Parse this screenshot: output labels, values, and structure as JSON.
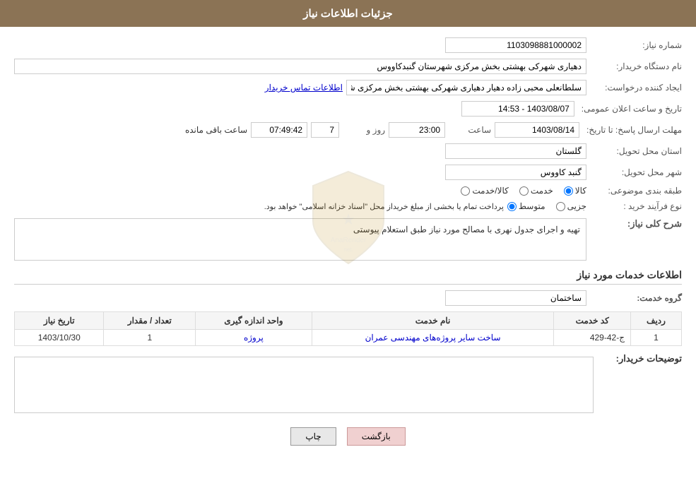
{
  "header": {
    "title": "جزئیات اطلاعات نیاز"
  },
  "form": {
    "need_number_label": "شماره نیاز:",
    "need_number_value": "1103098881000002",
    "buyer_org_label": "نام دستگاه خریدار:",
    "buyer_org_value": "دهیاری شهرکی بهشتی بخش مرکزی شهرستان گنبدکاووس",
    "creator_label": "ایجاد کننده درخواست:",
    "creator_value": "سلطانعلی محبی زاده دهیار دهیاری شهرکی بهشتی بخش مرکزی شهرستان گ",
    "creator_link": "اطلاعات تماس خریدار",
    "announce_label": "تاریخ و ساعت اعلان عمومی:",
    "announce_value": "1403/08/07 - 14:53",
    "deadline_label": "مهلت ارسال پاسخ: تا تاریخ:",
    "deadline_date": "1403/08/14",
    "deadline_time_label": "ساعت",
    "deadline_time": "23:00",
    "deadline_days_label": "روز و",
    "deadline_days": "7",
    "remaining_label": "ساعت باقی مانده",
    "remaining_time": "07:49:42",
    "province_label": "استان محل تحویل:",
    "province_value": "گلستان",
    "city_label": "شهر محل تحویل:",
    "city_value": "گنبد کاووس",
    "category_label": "طبقه بندی موضوعی:",
    "category_options": [
      {
        "id": "kala",
        "label": "کالا"
      },
      {
        "id": "khadamat",
        "label": "خدمت"
      },
      {
        "id": "kala_khadamat",
        "label": "کالا/خدمت"
      }
    ],
    "category_selected": "kala",
    "purchase_label": "نوع فرآیند خرید :",
    "purchase_options": [
      {
        "id": "jozi",
        "label": "جزیی"
      },
      {
        "id": "mottaset",
        "label": "متوسط"
      }
    ],
    "purchase_selected": "mottaset",
    "purchase_note": "پرداخت تمام یا بخشی از مبلغ خریداز محل \"اسناد خزانه اسلامی\" خواهد بود.",
    "description_label": "شرح کلی نیاز:",
    "description_value": "تهیه و اجرای جدول نهری با مصالح مورد نیاز طبق استعلام پیوستی",
    "services_title": "اطلاعات خدمات مورد نیاز",
    "service_group_label": "گروه خدمت:",
    "service_group_value": "ساختمان",
    "table": {
      "columns": [
        "ردیف",
        "کد خدمت",
        "نام خدمت",
        "واحد اندازه گیری",
        "تعداد / مقدار",
        "تاریخ نیاز"
      ],
      "rows": [
        {
          "row_num": "1",
          "service_code": "ج-42-429",
          "service_name": "ساخت سایر پروژه‌های مهندسی عمران",
          "unit": "پروژه",
          "qty": "1",
          "date": "1403/10/30"
        }
      ]
    },
    "buyer_desc_label": "توضیحات خریدار:",
    "buyer_desc_value": ""
  },
  "buttons": {
    "print_label": "چاپ",
    "back_label": "بازگشت"
  }
}
